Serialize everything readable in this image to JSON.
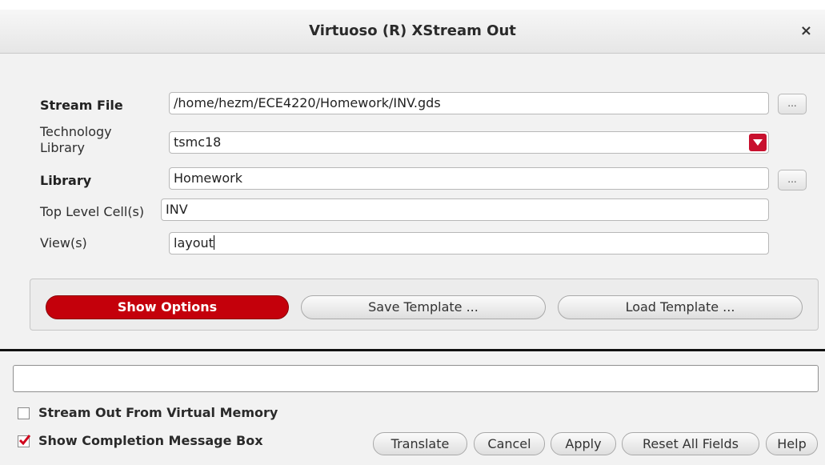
{
  "window": {
    "title": "Virtuoso (R) XStream Out",
    "close_label": "×"
  },
  "form": {
    "stream_file": {
      "label": "Stream File",
      "value": "/home/hezm/ECE4220/Homework/INV.gds",
      "browse_label": "..."
    },
    "technology_library": {
      "label_line1": "Technology",
      "label_line2": "Library",
      "value": "tsmc18"
    },
    "library": {
      "label": "Library",
      "value": "Homework",
      "browse_label": "..."
    },
    "top_level_cells": {
      "label": "Top Level Cell(s)",
      "value": "INV"
    },
    "views": {
      "label": "View(s)",
      "value": "layout"
    }
  },
  "options": {
    "show_options": "Show Options",
    "save_template": "Save Template ...",
    "load_template": "Load Template ..."
  },
  "status_message": "",
  "checkboxes": {
    "virtual_memory": {
      "label": "Stream Out From Virtual Memory",
      "checked": false
    },
    "completion_box": {
      "label": "Show Completion Message Box",
      "checked": true
    }
  },
  "buttons": {
    "translate": "Translate",
    "cancel": "Cancel",
    "apply": "Apply",
    "reset": "Reset All Fields",
    "help": "Help"
  },
  "colors": {
    "accent_red": "#c4000b",
    "check_red": "#d0021b"
  }
}
